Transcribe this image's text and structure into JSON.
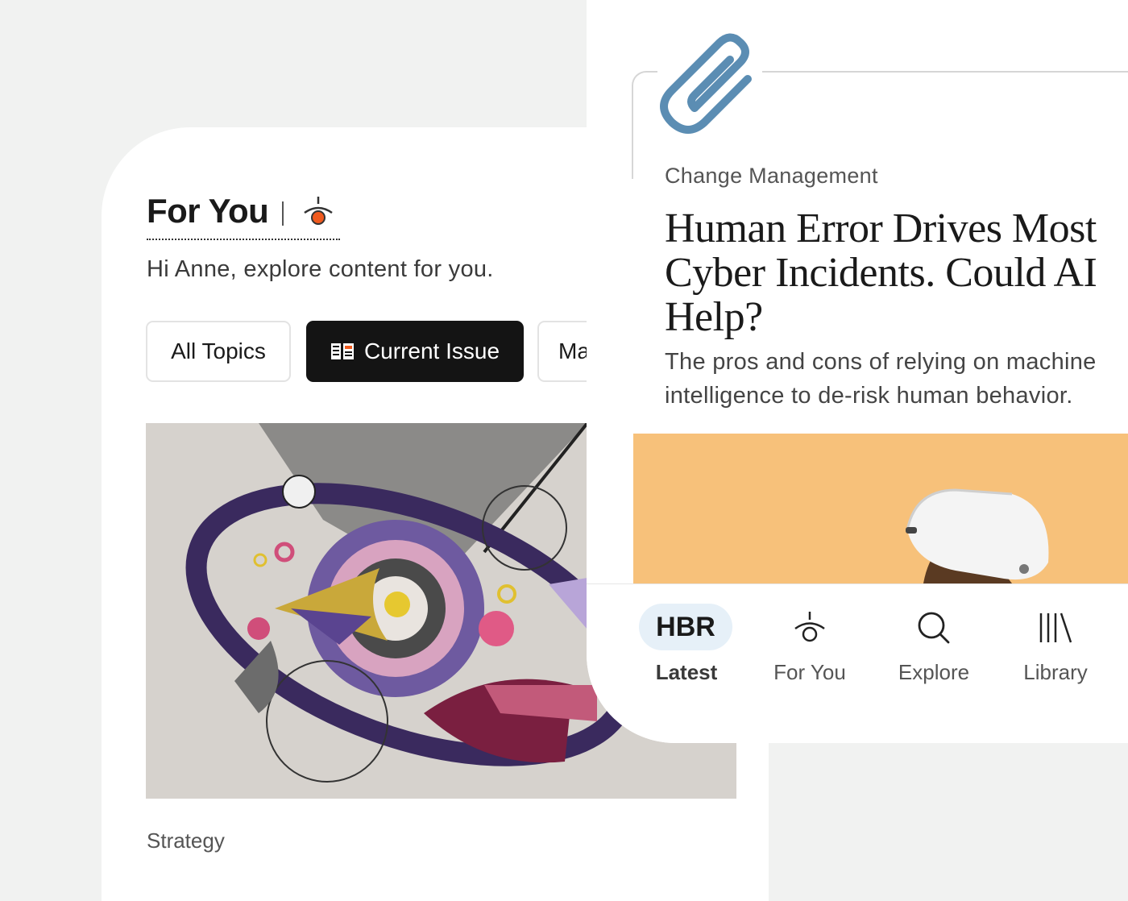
{
  "for_you": {
    "title": "For You",
    "greeting": "Hi Anne, explore content for you.",
    "chips": [
      "All Topics",
      "Current Issue",
      "Ma"
    ],
    "story_kicker": "Strategy"
  },
  "article": {
    "topic": "Change Management",
    "headline": "Human Error Drives Most Cyber Incidents. Could AI Help?",
    "dek": "The pros and cons of relying on machine intelligence to de-risk human behavior."
  },
  "tabbar": {
    "hbr_logo": "HBR",
    "tabs": [
      {
        "label": "Latest",
        "icon": "hbr-logo"
      },
      {
        "label": "For You",
        "icon": "for-you-icon"
      },
      {
        "label": "Explore",
        "icon": "search-icon"
      },
      {
        "label": "Library",
        "icon": "library-icon"
      }
    ]
  },
  "colors": {
    "accent_orange": "#f05a1e",
    "paperclip_blue": "#5b8db3",
    "chip_active": "#141414",
    "hbr_pill": "#e6f0f8",
    "article_image_bg": "#f7c17a"
  }
}
